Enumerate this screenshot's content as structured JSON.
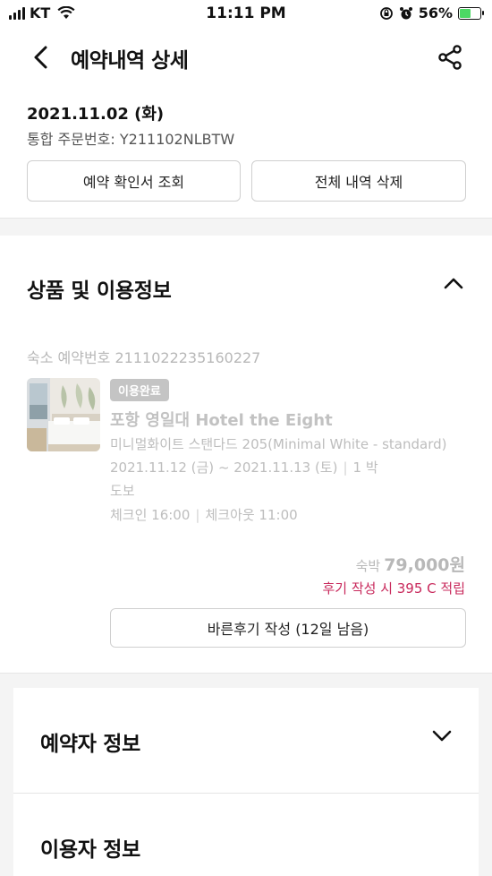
{
  "status_bar": {
    "carrier": "KT",
    "time": "11:11 PM",
    "battery_percent": "56%",
    "battery_level": 0.56,
    "battery_color": "#4cd964"
  },
  "header": {
    "title": "예약내역 상세",
    "back_icon": "chevron-left-icon",
    "share_icon": "share-icon"
  },
  "order": {
    "date": "2021.11.02 (화)",
    "order_number": "통합 주문번호: Y211102NLBTW",
    "confirm_button": "예약 확인서 조회",
    "delete_button": "전체 내역 삭제"
  },
  "product_section": {
    "title": "상품 및 이용정보",
    "expanded": true,
    "booking_number": "숙소 예약번호 2111022235160227",
    "status_badge": "이용완료",
    "hotel_name": "포항 영일대 Hotel the Eight",
    "room_type": "미니멀화이트 스탠다드 205(Minimal White - standard)",
    "check_in_date": "2021.11.12 (금)",
    "date_sep": "~",
    "check_out_date": "2021.11.13 (토)",
    "nights": "1 박",
    "access": "도보",
    "check_in": "체크인 16:00",
    "check_out": "체크아웃 11:00",
    "price_label": "숙박",
    "price_amount": "79,000원",
    "points_note": "후기 작성 시 395 C 적립",
    "review_button": "바른후기 작성 (12일 남음)"
  },
  "booker_section": {
    "title": "예약자 정보",
    "expanded": false
  },
  "user_section": {
    "title": "이용자 정보"
  },
  "colors": {
    "accent_pink": "#c8285b",
    "muted_text": "#bdbdbd",
    "badge_bg": "#c4c4c4",
    "band_bg": "#f4f4f4"
  }
}
